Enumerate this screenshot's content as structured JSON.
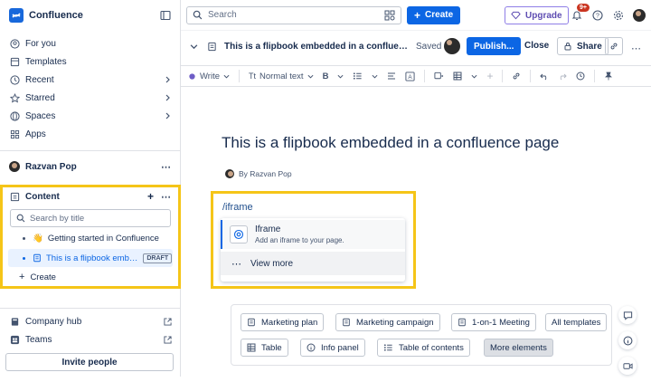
{
  "app": {
    "name": "Confluence"
  },
  "sidebar": {
    "nav": [
      {
        "label": "For you",
        "icon": "user-circle-icon"
      },
      {
        "label": "Templates",
        "icon": "templates-icon"
      },
      {
        "label": "Recent",
        "icon": "clock-icon"
      },
      {
        "label": "Starred",
        "icon": "star-icon"
      },
      {
        "label": "Spaces",
        "icon": "globe-icon"
      },
      {
        "label": "Apps",
        "icon": "apps-icon"
      }
    ],
    "space_name": "Razvan Pop",
    "content_label": "Content",
    "search_placeholder": "Search by title",
    "tree": [
      {
        "label": "Getting started in Confluence",
        "emoji": "👋"
      },
      {
        "label": "This is a flipbook emb…",
        "badge": "DRAFT"
      }
    ],
    "create_label": "Create",
    "bottom": [
      {
        "label": "Company hub",
        "icon": "book-icon"
      },
      {
        "label": "Teams",
        "icon": "people-icon"
      }
    ],
    "invite_label": "Invite people"
  },
  "topbar": {
    "search_placeholder": "Search",
    "create_label": "Create",
    "upgrade_label": "Upgrade",
    "notif_badge": "9+"
  },
  "pagebar": {
    "title": "This is a flipbook embedded in a confluence page",
    "status": "Saved",
    "publish_label": "Publish...",
    "close_label": "Close",
    "share_label": "Share"
  },
  "toolbar": {
    "write_label": "Write",
    "text_style": "Normal text"
  },
  "document": {
    "title": "This is a flipbook embedded in a confluence page",
    "byline": "By Razvan Pop",
    "slash_text": "/iframe",
    "menu": {
      "item_title": "Iframe",
      "item_desc": "Add an iframe to your page.",
      "more_label": "View more"
    }
  },
  "templates": {
    "row1": [
      "Marketing plan",
      "Marketing campaign",
      "1-on-1 Meeting",
      "All templates"
    ],
    "row2": [
      "Table",
      "Info panel",
      "Table of contents",
      "More elements"
    ]
  },
  "colors": {
    "brand": "#1868db",
    "primary": "#0c66e4",
    "highlight": "#f5c518"
  }
}
